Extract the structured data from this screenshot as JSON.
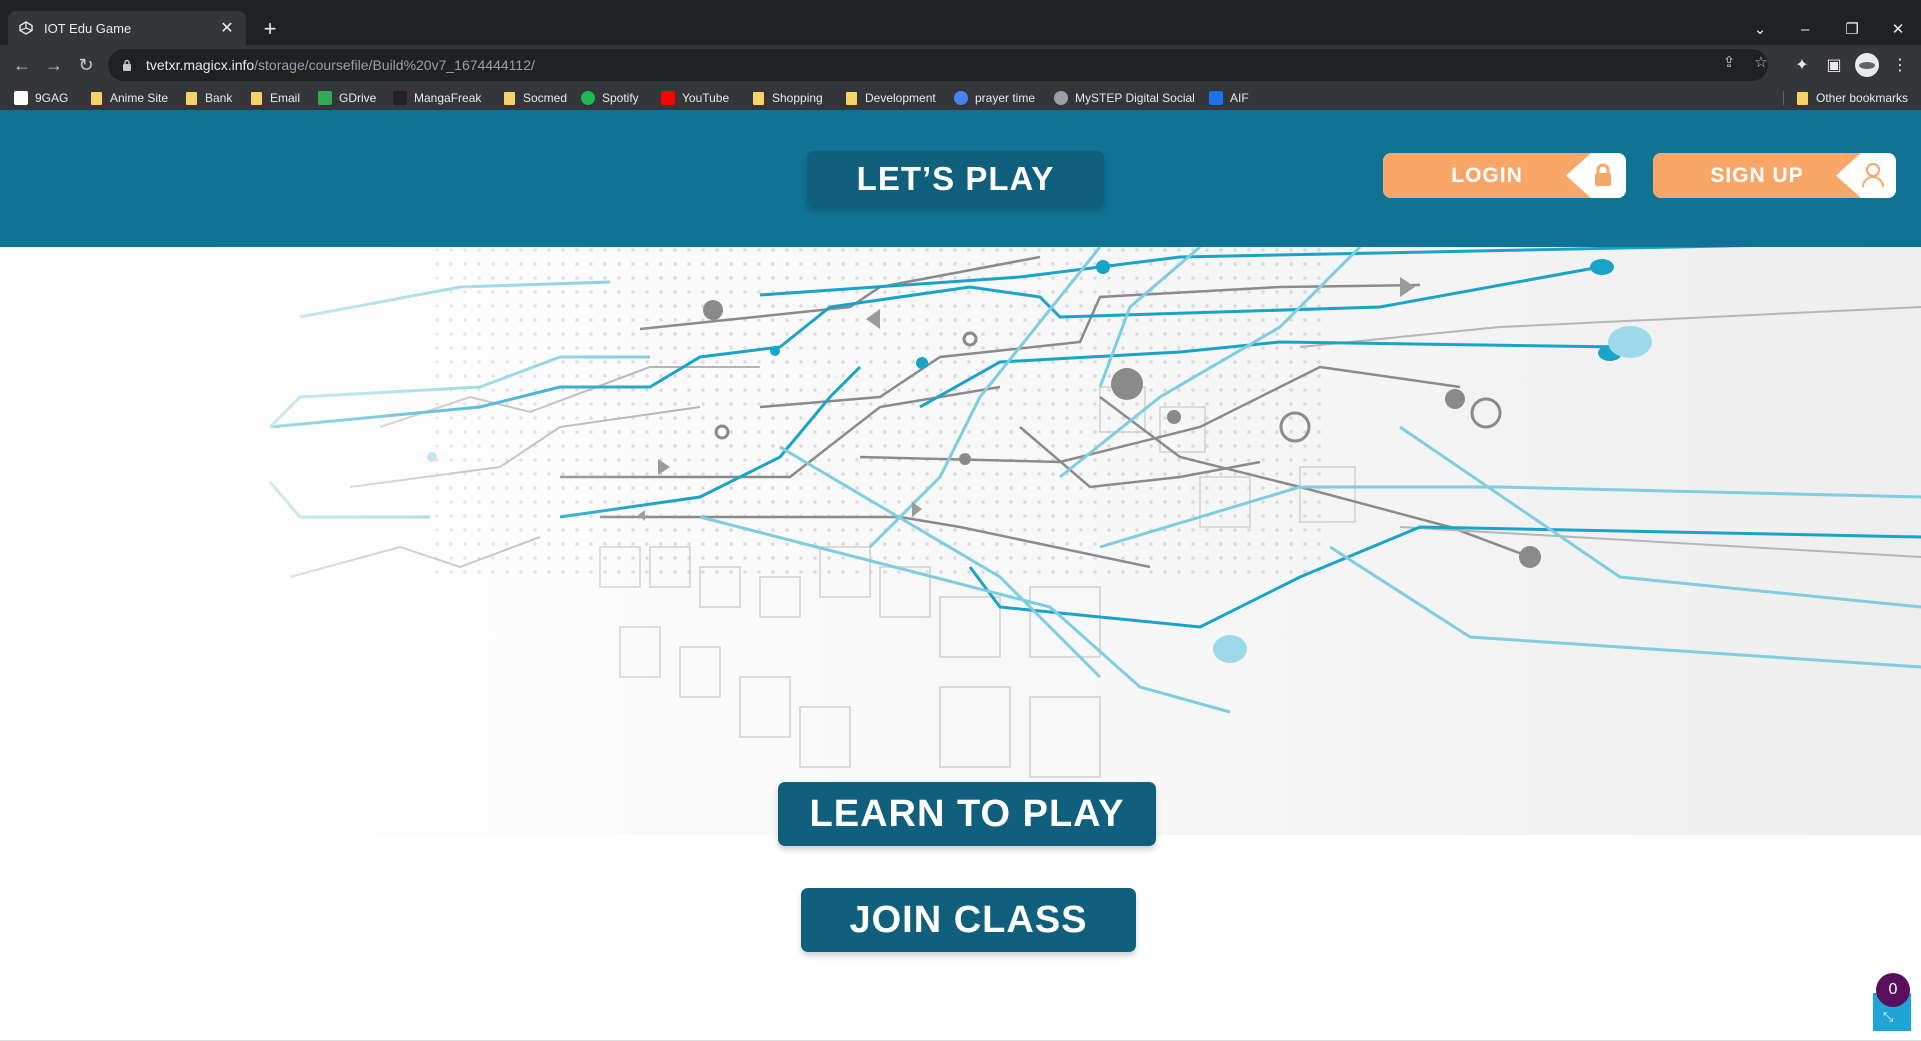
{
  "browser": {
    "tab_title": "IOT Edu Game",
    "url_host": "tvetxr.magicx.info",
    "url_path": "/storage/coursefile/Build%20v7_1674444112/",
    "bookmarks": [
      {
        "label": "9GAG",
        "icon": "9gag-icon",
        "color": "#ffffff"
      },
      {
        "label": "Anime Site",
        "icon": "folder-icon",
        "color": "#f6d36b"
      },
      {
        "label": "Bank",
        "icon": "folder-icon",
        "color": "#f6d36b"
      },
      {
        "label": "Email",
        "icon": "folder-icon",
        "color": "#f6d36b"
      },
      {
        "label": "GDrive",
        "icon": "gdrive-icon",
        "color": "#34a853"
      },
      {
        "label": "MangaFreak",
        "icon": "mangafreak-icon",
        "color": "#222222"
      },
      {
        "label": "Socmed",
        "icon": "folder-icon",
        "color": "#f6d36b"
      },
      {
        "label": "Spotify",
        "icon": "spotify-icon",
        "color": "#1db954"
      },
      {
        "label": "YouTube",
        "icon": "youtube-icon",
        "color": "#ff0000"
      },
      {
        "label": "Shopping",
        "icon": "folder-icon",
        "color": "#f6d36b"
      },
      {
        "label": "Development",
        "icon": "folder-icon",
        "color": "#f6d36b"
      },
      {
        "label": "prayer time",
        "icon": "google-icon",
        "color": "#4285f4"
      },
      {
        "label": "MySTEP Digital Social",
        "icon": "mystep-icon",
        "color": "#9aa0a6"
      },
      {
        "label": "AIF",
        "icon": "aif-icon",
        "color": "#1a73e8"
      }
    ],
    "other_bookmarks": "Other bookmarks"
  },
  "game": {
    "lets_play": "LET’S PLAY",
    "login": "LOGIN",
    "sign_up": "SIGN UP",
    "learn_to_play": "LEARN TO PLAY",
    "join_class": "JOIN CLASS",
    "notification_count": "0"
  },
  "colors": {
    "header": "#107294",
    "button_dark": "#0f5f7d",
    "button_orange": "#f9a769",
    "circuit_blue": "#1aa3c8",
    "circuit_gray": "#9a9a9a",
    "badge": "#5a0f5c",
    "corner_button": "#1ea4d6"
  }
}
